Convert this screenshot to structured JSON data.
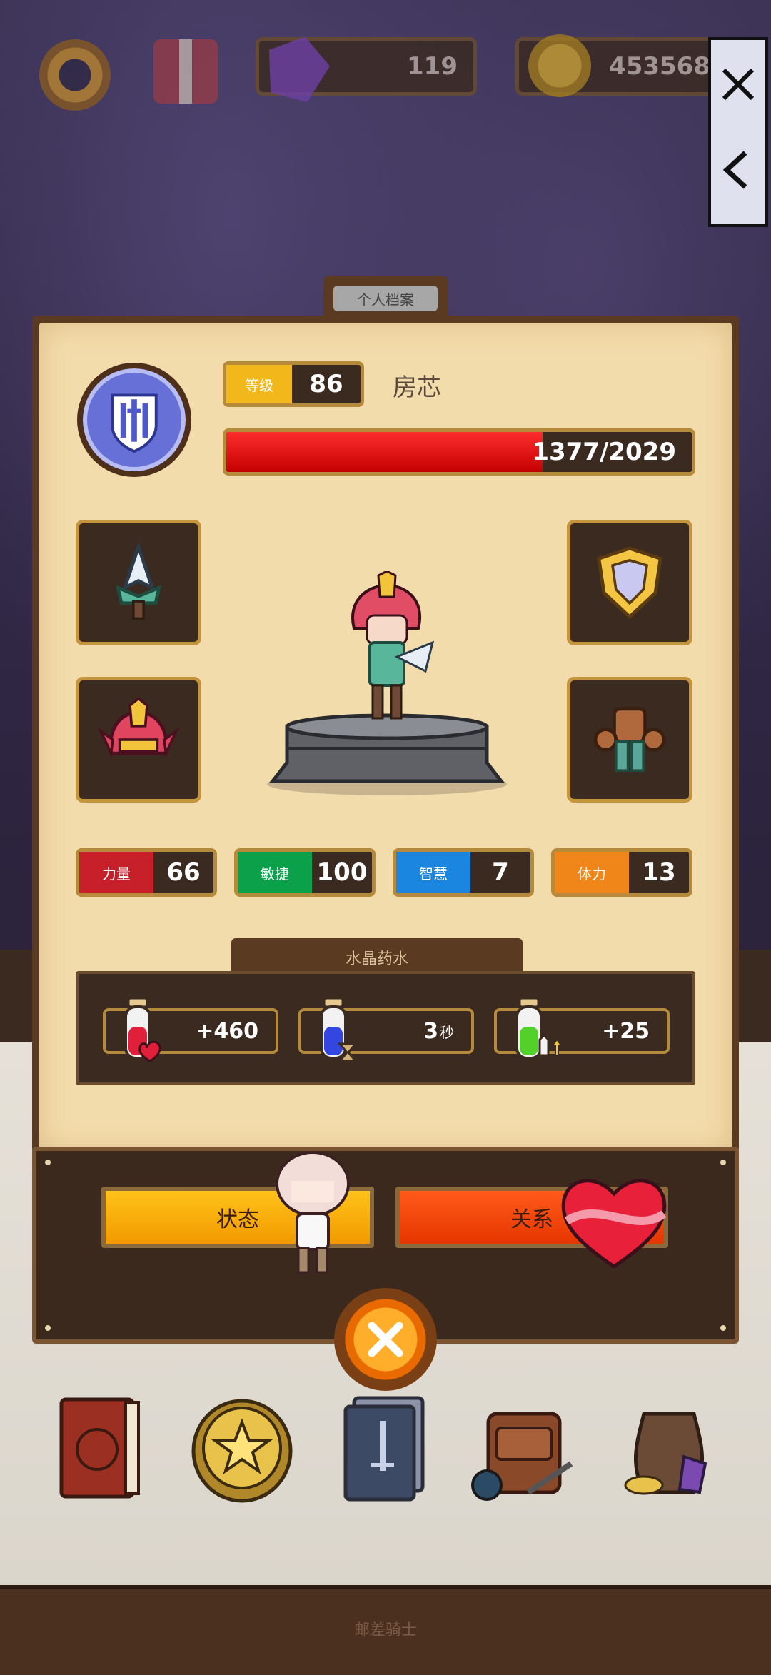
{
  "hud": {
    "gems": "119",
    "gold": "453568"
  },
  "panel": {
    "tab_label": "个人档案",
    "level_label": "等级",
    "level": "86",
    "hero_name": "房芯",
    "hp_text": "1377/2029",
    "hp_fraction": 0.679
  },
  "stats": [
    {
      "label": "力量",
      "value": "66",
      "color": "#c8202a"
    },
    {
      "label": "敏捷",
      "value": "100",
      "color": "#0aa14a"
    },
    {
      "label": "智慧",
      "value": "7",
      "color": "#1b86e0"
    },
    {
      "label": "体力",
      "value": "13",
      "color": "#f0861a"
    }
  ],
  "potions": {
    "title": "水晶药水",
    "items": [
      {
        "value": "+460",
        "icon": "red-potion-heart-icon"
      },
      {
        "value": "3",
        "unit": "秒",
        "icon": "blue-potion-hourglass-icon"
      },
      {
        "value": "+25",
        "icon": "green-potion-sword-icon"
      }
    ]
  },
  "buttons": {
    "status": "状态",
    "relation": "关系"
  },
  "footer": "邮差骑士",
  "colors": {
    "panel_bg": "#f3dcab",
    "panel_frame": "#5b3a22",
    "hp_red": "#e00000",
    "level_gold": "#f2b81b"
  }
}
